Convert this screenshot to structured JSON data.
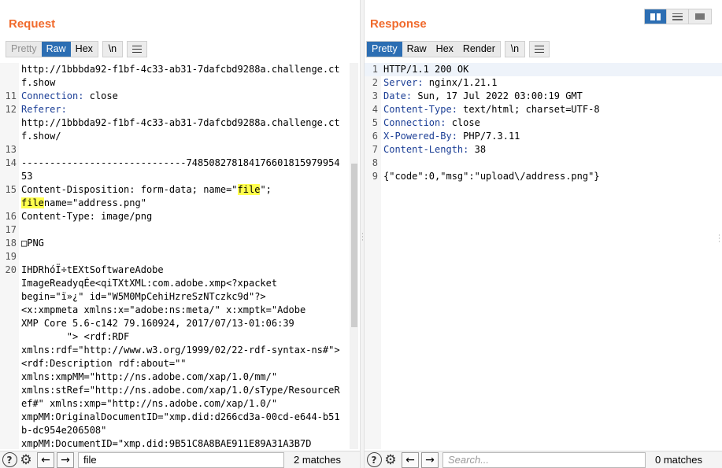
{
  "request": {
    "title": "Request",
    "tabs": [
      {
        "label": "Pretty",
        "state": "disabled"
      },
      {
        "label": "Raw",
        "state": "active"
      },
      {
        "label": "Hex",
        "state": "normal"
      }
    ],
    "newline_label": "\\n",
    "lines": [
      {
        "num": "",
        "text": "http://1bbbda92-f1bf-4c33-ab31-7dafcbd9288a.challenge.ctf.show"
      },
      {
        "num": "11",
        "key": "Connection:",
        "text": " close"
      },
      {
        "num": "12",
        "key": "Referer:",
        "text": ""
      },
      {
        "num": "",
        "text": "http://1bbbda92-f1bf-4c33-ab31-7dafcbd9288a.challenge.ctf.show/"
      },
      {
        "num": "13",
        "text": ""
      },
      {
        "num": "14",
        "text": "-----------------------------74850827818417660181597995453"
      },
      {
        "num": "15",
        "text": "Content-Disposition: form-data; name=\"file\";\nfilename=\"address.png\""
      },
      {
        "num": "16",
        "text": "Content-Type: image/png"
      },
      {
        "num": "17",
        "text": ""
      },
      {
        "num": "18",
        "text": "□PNG"
      },
      {
        "num": "19",
        "text": ""
      },
      {
        "num": "20",
        "text": "IHDRhóÏ÷tEXtSoftwareAdobe\nImageReadyqÉe<qiTXtXML:com.adobe.xmp<?xpacket\nbegin=\"ï»¿\" id=\"W5M0MpCehiHzreSzNTczkc9d\"?>\n<x:xmpmeta xmlns:x=\"adobe:ns:meta/\" x:xmptk=\"Adobe\nXMP Core 5.6-c142 79.160924, 2017/07/13-01:06:39\n        \"> <rdf:RDF\nxmlns:rdf=\"http://www.w3.org/1999/02/22-rdf-syntax-ns#\"> <rdf:Description rdf:about=\"\"\nxmlns:xmpMM=\"http://ns.adobe.com/xap/1.0/mm/\"\nxmlns:stRef=\"http://ns.adobe.com/xap/1.0/sType/ResourceRef#\" xmlns:xmp=\"http://ns.adobe.com/xap/1.0/\"\nxmpMM:OriginalDocumentID=\"xmp.did:d266cd3a-00cd-e644-b51b-dc954e206508\"\nxmpMM:DocumentID=\"xmp.did:9B51C8A8BAE911E89A31A3B7D"
      }
    ],
    "search": {
      "value": "file",
      "matches": "2 matches"
    }
  },
  "response": {
    "title": "Response",
    "tabs": [
      {
        "label": "Pretty",
        "state": "active"
      },
      {
        "label": "Raw",
        "state": "normal"
      },
      {
        "label": "Hex",
        "state": "normal"
      },
      {
        "label": "Render",
        "state": "normal"
      }
    ],
    "newline_label": "\\n",
    "lines": [
      {
        "num": "1",
        "text": "HTTP/1.1 200 OK"
      },
      {
        "num": "2",
        "key": "Server:",
        "text": " nginx/1.21.1"
      },
      {
        "num": "3",
        "key": "Date:",
        "text": " Sun, 17 Jul 2022 03:00:19 GMT"
      },
      {
        "num": "4",
        "key": "Content-Type:",
        "text": " text/html; charset=UTF-8"
      },
      {
        "num": "5",
        "key": "Connection:",
        "text": " close"
      },
      {
        "num": "6",
        "key": "X-Powered-By:",
        "text": " PHP/7.3.11"
      },
      {
        "num": "7",
        "key": "Content-Length:",
        "text": " 38"
      },
      {
        "num": "8",
        "text": ""
      },
      {
        "num": "9",
        "text": "{\"code\":0,\"msg\":\"upload\\/address.png\"}"
      }
    ],
    "search": {
      "placeholder": "Search...",
      "matches": "0 matches"
    }
  },
  "icons": {
    "help": "help-icon",
    "settings": "gear-icon",
    "back": "arrow-left-icon",
    "forward": "arrow-right-icon",
    "menu": "hamburger-menu-icon",
    "layout_columns": "split-columns-icon",
    "layout_rows": "split-rows-icon",
    "layout_single": "single-pane-icon"
  },
  "colors": {
    "accent": "#2c6eb3",
    "title": "#f06a2c",
    "header_key": "#1c3f96",
    "search_highlight": "#ffff4d"
  }
}
